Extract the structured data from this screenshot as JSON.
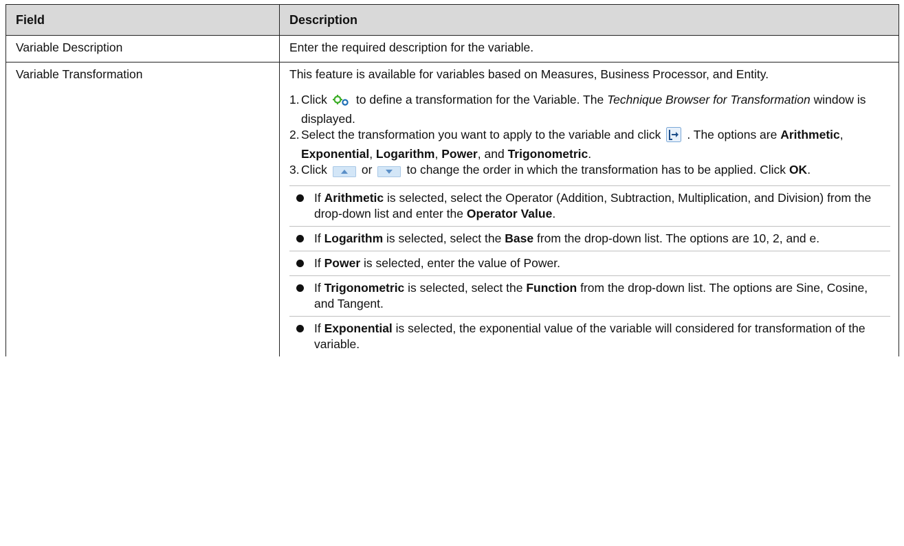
{
  "table": {
    "header": {
      "field": "Field",
      "description": "Description"
    },
    "row1": {
      "field": "Variable Description",
      "description": "Enter the required description for the variable."
    },
    "row2": {
      "field": "Variable Transformation",
      "intro": "This feature is available for variables based on Measures, Business Processor, and Entity.",
      "step1": {
        "num": "1.",
        "click": "Click",
        "icon": "transformation-gear-icon",
        "text_a": "to define a transformation for the Variable. The",
        "italic": "Technique Browser for Transformation",
        "text_b": "window is displayed."
      },
      "step2": {
        "num": "2.",
        "text_a": "Select the transformation you want to apply to the variable and click",
        "icon": "move-right-icon",
        "text_b": ". The options are",
        "opt1": "Arithmetic",
        "opt2": "Exponential",
        "opt3": "Logarithm",
        "opt4": "Power",
        "and": "and",
        "opt5": "Trigonometric"
      },
      "step3": {
        "num": "3.",
        "click": "Click",
        "icon_up": "move-up-icon",
        "or": "or",
        "icon_down": "move-down-icon",
        "text_a": "to change the order in which the transformation has to be applied. Click",
        "ok": "OK"
      },
      "bullets": {
        "b1": {
          "pre": "If",
          "bold1": "Arithmetic",
          "mid": "is selected, select the Operator (Addition, Subtraction, Multiplication, and Division) from the drop-down list and enter the",
          "bold2": "Operator Value"
        },
        "b2": {
          "pre": "If",
          "bold1": "Logarithm",
          "mid": "is selected, select the",
          "bold2": "Base",
          "post": "from the drop-down list. The options are 10, 2, and e."
        },
        "b3": {
          "pre": "If",
          "bold1": "Power",
          "post": "is selected, enter the value of Power."
        },
        "b4": {
          "pre": "If",
          "bold1": "Trigonometric",
          "mid": "is selected, select the",
          "bold2": "Function",
          "post": "from the drop-down list. The options are Sine, Cosine, and Tangent."
        },
        "b5": {
          "pre": "If",
          "bold1": "Exponential",
          "post": "is selected, the exponential value of the variable will considered for transformation of the variable."
        }
      }
    }
  },
  "colors": {
    "header_bg": "#d9d9d9",
    "icon_green": "#3fae29",
    "icon_blue": "#1f6fb5"
  }
}
